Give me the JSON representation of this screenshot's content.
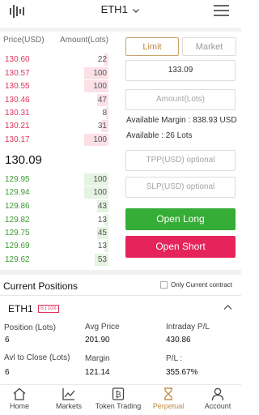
{
  "header": {
    "title": "ETH1",
    "logo_icon": "candlestick-chart-icon",
    "menu_icon": "hamburger-menu-icon"
  },
  "orderbook": {
    "price_header": "Price(USD)",
    "amount_header": "Amount(Lots)",
    "asks": [
      {
        "price": "130.60",
        "amount": "22",
        "depth": 0.21
      },
      {
        "price": "130.57",
        "amount": "100",
        "depth": 1.0
      },
      {
        "price": "130.55",
        "amount": "100",
        "depth": 1.0
      },
      {
        "price": "130.46",
        "amount": "47",
        "depth": 0.45
      },
      {
        "price": "130.31",
        "amount": "8",
        "depth": 0.1
      },
      {
        "price": "130.21",
        "amount": "31",
        "depth": 0.3
      },
      {
        "price": "130.17",
        "amount": "100",
        "depth": 1.0
      }
    ],
    "last_price": "130.09",
    "bids": [
      {
        "price": "129.95",
        "amount": "100",
        "depth": 1.0
      },
      {
        "price": "129.94",
        "amount": "100",
        "depth": 1.0
      },
      {
        "price": "129.86",
        "amount": "43",
        "depth": 0.45
      },
      {
        "price": "129.82",
        "amount": "13",
        "depth": 0.15
      },
      {
        "price": "129.75",
        "amount": "45",
        "depth": 0.45
      },
      {
        "price": "129.69",
        "amount": "13",
        "depth": 0.15
      },
      {
        "price": "129.62",
        "amount": "53",
        "depth": 0.55
      }
    ]
  },
  "order_form": {
    "tab_limit": "Limit",
    "tab_market": "Market",
    "price_value": "133.09",
    "amount_placeholder": "Amount(Lots)",
    "available_margin": "Available Margin : 838.93 USD",
    "available_lots": "Available : 26 Lots",
    "tpp_placeholder": "TPP(USD) optional",
    "slp_placeholder": "SLP(USD) optional",
    "open_long": "Open Long",
    "open_short": "Open Short"
  },
  "positions": {
    "title": "Current Positions",
    "only_current": "Only Current contract",
    "symbol": "ETH1",
    "badge": "S | 10X",
    "position_label": "Position (Lots)",
    "position_value": "6",
    "avg_price_label": "Avg Price",
    "avg_price_value": "201.90",
    "intraday_label": "Intraday P/L",
    "intraday_value": "430.86",
    "avl_close_label": "Avl to Close (Lots)",
    "avl_close_value": "6",
    "margin_label": "Margin",
    "margin_value": "121.14",
    "pl_label": "P/L :",
    "pl_value": "355.67%"
  },
  "nav": {
    "items": [
      {
        "label": "Home",
        "icon": "home-icon"
      },
      {
        "label": "Markets",
        "icon": "chart-line-icon"
      },
      {
        "label": "Token Trading",
        "icon": "token-icon"
      },
      {
        "label": "Perpetual",
        "icon": "hourglass-icon",
        "active": true
      },
      {
        "label": "Account",
        "icon": "user-icon"
      }
    ]
  },
  "colors": {
    "accent": "#c08a3e",
    "long": "#36ad36",
    "short": "#e6245c",
    "ask": "#e0345d",
    "bid": "#3c9b30"
  }
}
